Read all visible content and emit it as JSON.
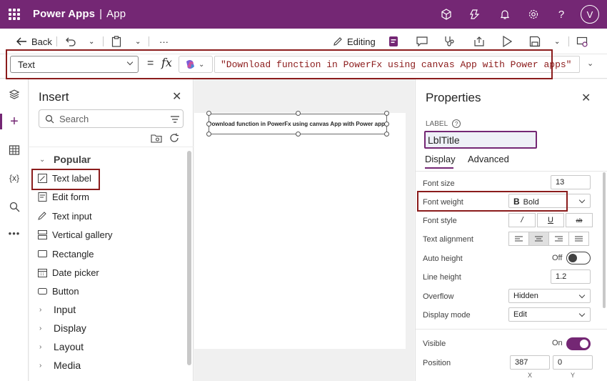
{
  "topbar": {
    "app_name": "Power Apps",
    "separator": "|",
    "app_title": "App",
    "user_initial": "V"
  },
  "commands": {
    "back": "Back",
    "more": "···",
    "editing": "Editing"
  },
  "formula": {
    "property": "Text",
    "equals": "=",
    "fx": "fx",
    "expression": "\"Download function in PowerFx using canvas App with Power apps\""
  },
  "insert": {
    "title": "Insert",
    "search_placeholder": "Search",
    "popular": "Popular",
    "items": [
      "Text label",
      "Edit form",
      "Text input",
      "Vertical gallery",
      "Rectangle",
      "Date picker",
      "Button"
    ],
    "sections": [
      "Input",
      "Display",
      "Layout",
      "Media"
    ]
  },
  "canvas": {
    "label_text": "Download function in PowerFx using canvas App with Power apps"
  },
  "properties": {
    "title": "Properties",
    "caption": "LABEL",
    "control_name": "LblTitle",
    "tabs": [
      "Display",
      "Advanced"
    ],
    "font_size_label": "Font size",
    "font_size": "13",
    "font_weight_label": "Font weight",
    "font_weight": "Bold",
    "font_weight_glyph": "B",
    "font_style_label": "Font style",
    "font_style": [
      "/",
      "U",
      "ab"
    ],
    "text_alignment_label": "Text alignment",
    "auto_height_label": "Auto height",
    "auto_height": "Off",
    "line_height_label": "Line height",
    "line_height": "1.2",
    "overflow_label": "Overflow",
    "overflow": "Hidden",
    "display_mode_label": "Display mode",
    "display_mode": "Edit",
    "visible_label": "Visible",
    "visible": "On",
    "position_label": "Position",
    "position_x": "387",
    "position_y": "0",
    "x_label": "X",
    "y_label": "Y"
  },
  "colors": {
    "brand": "#742774",
    "highlight": "#8b1c1c"
  }
}
